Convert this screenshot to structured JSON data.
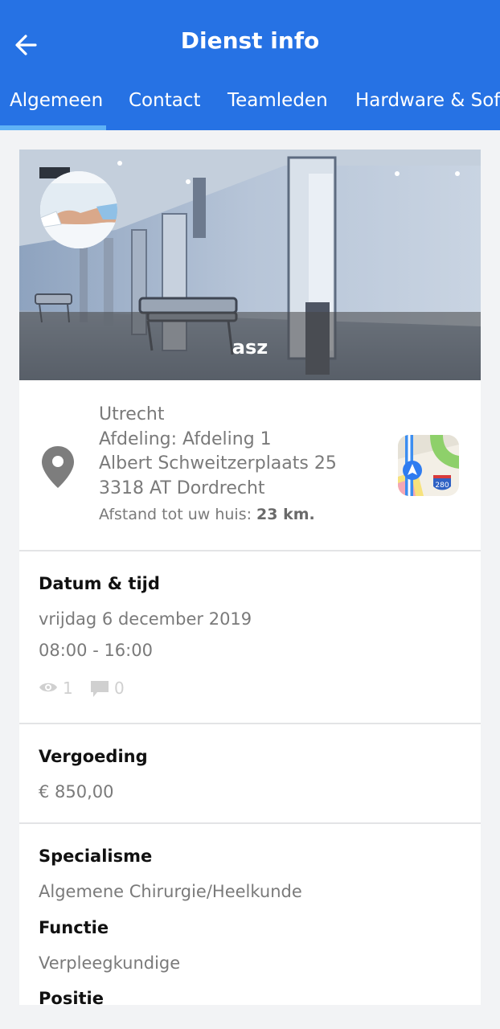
{
  "header": {
    "title": "Dienst info",
    "background": "#2672e4"
  },
  "tabs": [
    {
      "label": "Algemeen",
      "active": true
    },
    {
      "label": "Contact",
      "active": false
    },
    {
      "label": "Teamleden",
      "active": false
    },
    {
      "label": "Hardware & Software",
      "active": false
    }
  ],
  "hero": {
    "organization_name": "asz"
  },
  "location": {
    "city": "Utrecht",
    "department": "Afdeling: Afdeling 1",
    "street": "Albert Schweitzerplaats 25",
    "postal": "3318 AT Dordrecht",
    "distance_label": "Afstand tot uw huis:",
    "distance_value": "23 km."
  },
  "datetime": {
    "heading": "Datum & tijd",
    "date": "vrijdag 6 december 2019",
    "time": "08:00 - 16:00",
    "views": "1",
    "comments": "0"
  },
  "compensation": {
    "heading": "Vergoeding",
    "amount": "€ 850,00"
  },
  "specialism": {
    "heading": "Specialisme",
    "value": "Algemene Chirurgie/Heelkunde",
    "function_heading": "Functie",
    "function_value": "Verpleegkundige",
    "position_heading": "Positie"
  }
}
